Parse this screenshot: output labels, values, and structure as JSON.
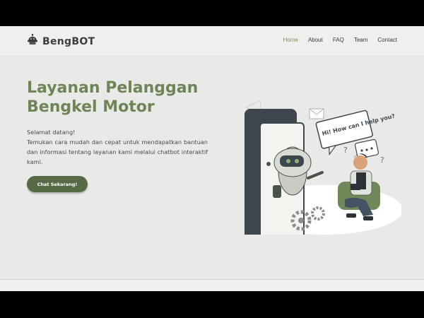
{
  "brand": {
    "name": "BengBOT"
  },
  "nav": {
    "items": [
      "Home",
      "About",
      "FAQ",
      "Team",
      "Contact"
    ],
    "active": "Home"
  },
  "hero": {
    "title_line1": "Layanan Pelanggan",
    "title_line2": "Bengkel Motor",
    "greeting": "Selamat datang!",
    "description": "Temukan cara mudah dan cepat untuk mendapatkan bantuan dan informasi tentang layanan kami melalui chatbot interaktif kami.",
    "cta_label": "Chat Sekarang!"
  },
  "illustration": {
    "speech_bubble": "Hi! How can I help you?"
  },
  "colors": {
    "accent": "#6d8557",
    "button": "#566a45",
    "nav_active": "#6f9a5b"
  },
  "icons": {
    "logo": "robot-icon"
  }
}
